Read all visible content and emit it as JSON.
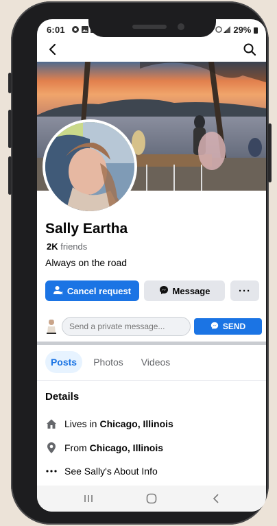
{
  "status_bar": {
    "time": "6:01",
    "battery": "29%"
  },
  "profile": {
    "name": "Sally Eartha",
    "friends_count": "2K",
    "friends_label": "friends",
    "bio": "Always on the road"
  },
  "actions": {
    "cancel_request": "Cancel request",
    "message": "Message",
    "more": "···"
  },
  "private_message": {
    "placeholder": "Send a private message...",
    "send_label": "SEND"
  },
  "tabs": [
    {
      "label": "Posts",
      "active": true
    },
    {
      "label": "Photos",
      "active": false
    },
    {
      "label": "Videos",
      "active": false
    }
  ],
  "details": {
    "heading": "Details",
    "lives_prefix": "Lives in",
    "lives_city": "Chicago, Illinois",
    "from_prefix": "From",
    "from_city": "Chicago, Illinois",
    "about_link": "See Sally's About Info"
  },
  "colors": {
    "accent": "#1b74e4",
    "tab_active_bg": "#e7f3ff",
    "button_secondary": "#e4e6eb"
  },
  "icons": {
    "back": "arrow-left-icon",
    "search": "search-icon",
    "cancel_request": "person-cancel-icon",
    "message": "messenger-icon",
    "home": "home-icon",
    "location": "location-pin-icon",
    "more": "more-dots-icon"
  }
}
